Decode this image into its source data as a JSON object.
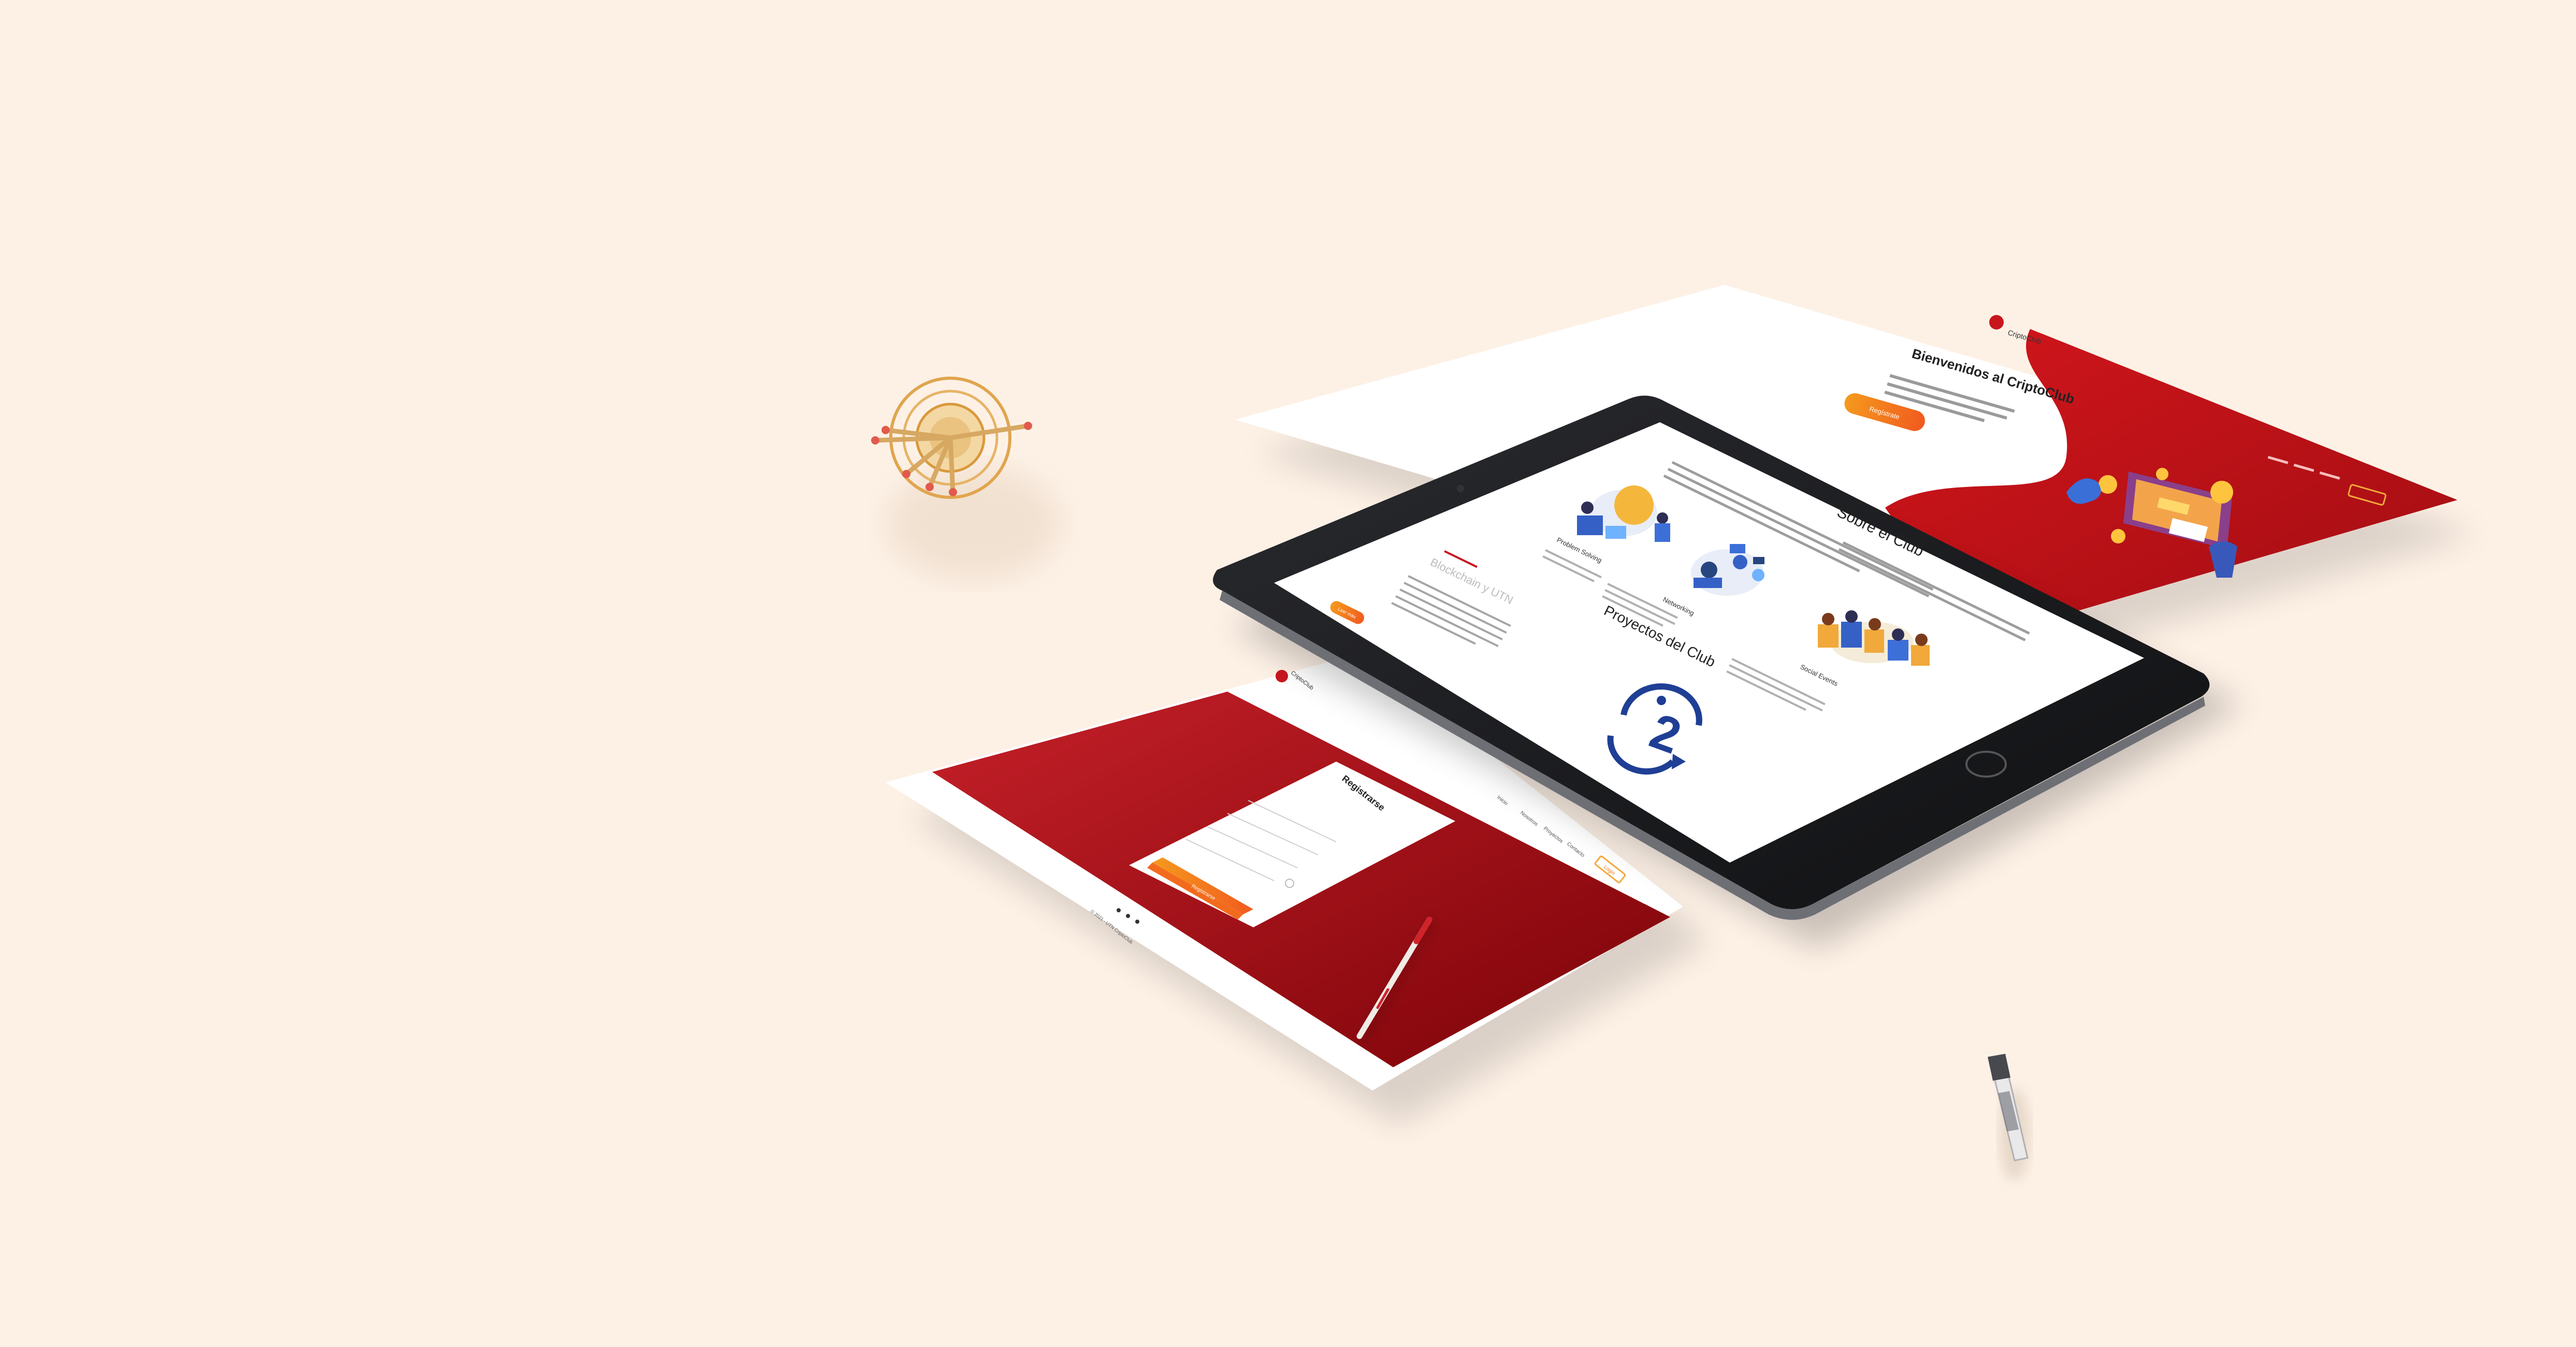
{
  "welcome_page": {
    "heading": "Bienvenidos al CriptoClub",
    "cta_label": "Regístrate",
    "logo_text": "CriptoClub"
  },
  "tablet_page": {
    "section_about_title": "Sobre el Club",
    "features": [
      {
        "label": "Problem Solving"
      },
      {
        "label": "Networking"
      },
      {
        "label": "Social Events"
      }
    ],
    "side_title": "Blockchain y UTN",
    "side_button": "Leer más",
    "section_projects_title": "Proyectos del Club",
    "project_logo_digit": "2"
  },
  "register_page": {
    "form_title": "Registrarse",
    "submit_label": "Registrarse",
    "nav_items": [
      "Inicio",
      "Nosotros",
      "Proyectos",
      "Contacto"
    ],
    "nav_cta": "Login",
    "footer_text": "© 2021 - UTN CriptoClub",
    "logo_text": "CriptoClub"
  },
  "colors": {
    "background": "#fdf1e6",
    "brand_red": "#b5121b",
    "brand_orange": "#f27a1a",
    "tablet_frame": "#1c1d20"
  }
}
